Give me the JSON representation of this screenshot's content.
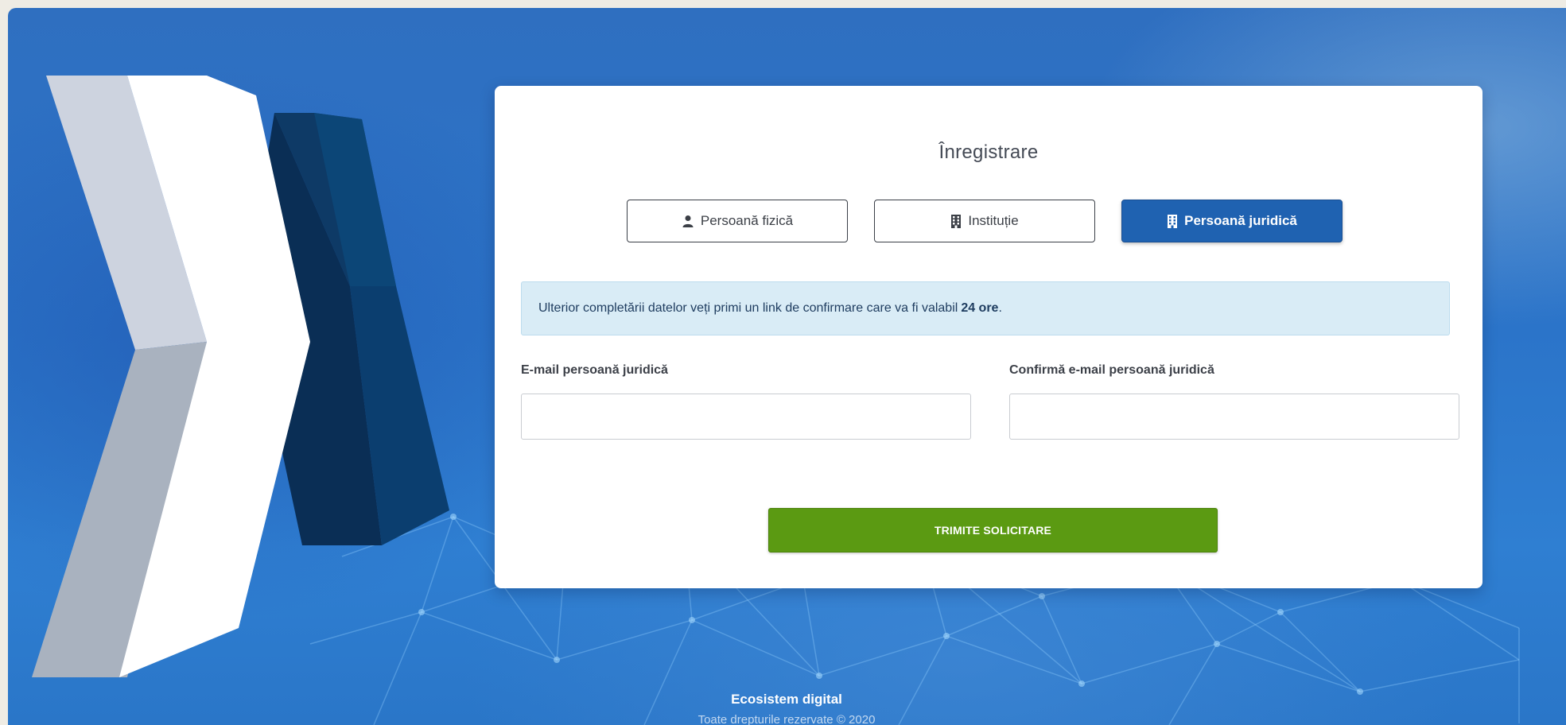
{
  "registration": {
    "title": "Înregistrare",
    "types": [
      {
        "label": "Persoană fizică",
        "icon": "user-icon",
        "active": false
      },
      {
        "label": "Instituție",
        "icon": "building-icon",
        "active": false
      },
      {
        "label": "Persoană juridică",
        "icon": "building-icon",
        "active": true
      }
    ],
    "info": {
      "text": "Ulterior completării datelor veți primi un link de confirmare care va fi valabil",
      "highlight": "24 ore",
      "suffix": "."
    },
    "fields": [
      {
        "label": "E-mail persoană juridică",
        "value": "",
        "placeholder": ""
      },
      {
        "label": "Confirmă e-mail persoană juridică",
        "value": "",
        "placeholder": ""
      }
    ],
    "submit_label": "TRIMITE SOLICITARE"
  },
  "footer": {
    "title": "Ecosistem digital",
    "copyright": "Toate drepturile rezervate © 2020"
  },
  "colors": {
    "active_tab": "#1f62b1",
    "submit": "#5b9a12",
    "info_bg": "#d9ecf6"
  }
}
